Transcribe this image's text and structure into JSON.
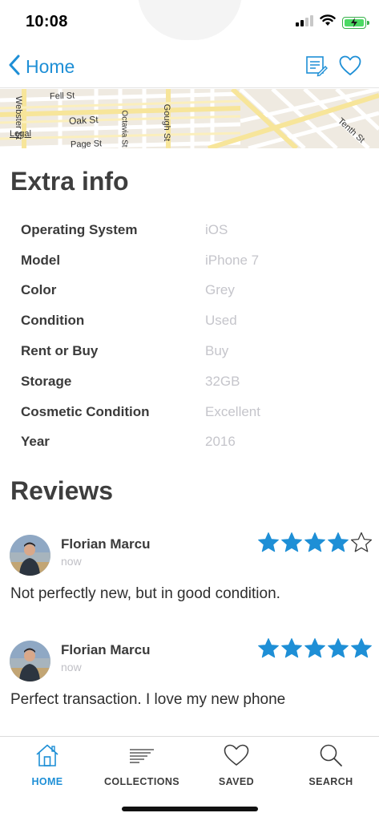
{
  "status_bar": {
    "time": "10:08"
  },
  "nav": {
    "back_label": "Home"
  },
  "map": {
    "streets": [
      "Fell St",
      "Oak St",
      "Page St",
      "Webster St",
      "Octavia St",
      "Gough St",
      "Tenth St"
    ],
    "legal_label": "Legal"
  },
  "extra_info": {
    "title": "Extra info",
    "rows": [
      {
        "key": "Operating System",
        "value": "iOS"
      },
      {
        "key": "Model",
        "value": "iPhone 7"
      },
      {
        "key": "Color",
        "value": "Grey"
      },
      {
        "key": "Condition",
        "value": "Used"
      },
      {
        "key": "Rent or Buy",
        "value": "Buy"
      },
      {
        "key": "Storage",
        "value": "32GB"
      },
      {
        "key": "Cosmetic Condition",
        "value": "Excellent"
      },
      {
        "key": "Year",
        "value": "2016"
      }
    ]
  },
  "reviews": {
    "title": "Reviews",
    "items": [
      {
        "author": "Florian Marcu",
        "time": "now",
        "rating": 4,
        "max_rating": 5,
        "text": "Not perfectly new, but in good condition."
      },
      {
        "author": "Florian Marcu",
        "time": "now",
        "rating": 5,
        "max_rating": 5,
        "text": "Perfect transaction. I love my new phone"
      }
    ]
  },
  "tabs": [
    {
      "label": "HOME",
      "icon": "home-icon",
      "active": true
    },
    {
      "label": "COLLECTIONS",
      "icon": "collections-icon",
      "active": false
    },
    {
      "label": "SAVED",
      "icon": "heart-icon",
      "active": false
    },
    {
      "label": "SEARCH",
      "icon": "search-icon",
      "active": false
    }
  ],
  "colors": {
    "accent": "#1e8fd6",
    "star": "#1e8fd6",
    "muted": "#c5c5cb"
  }
}
